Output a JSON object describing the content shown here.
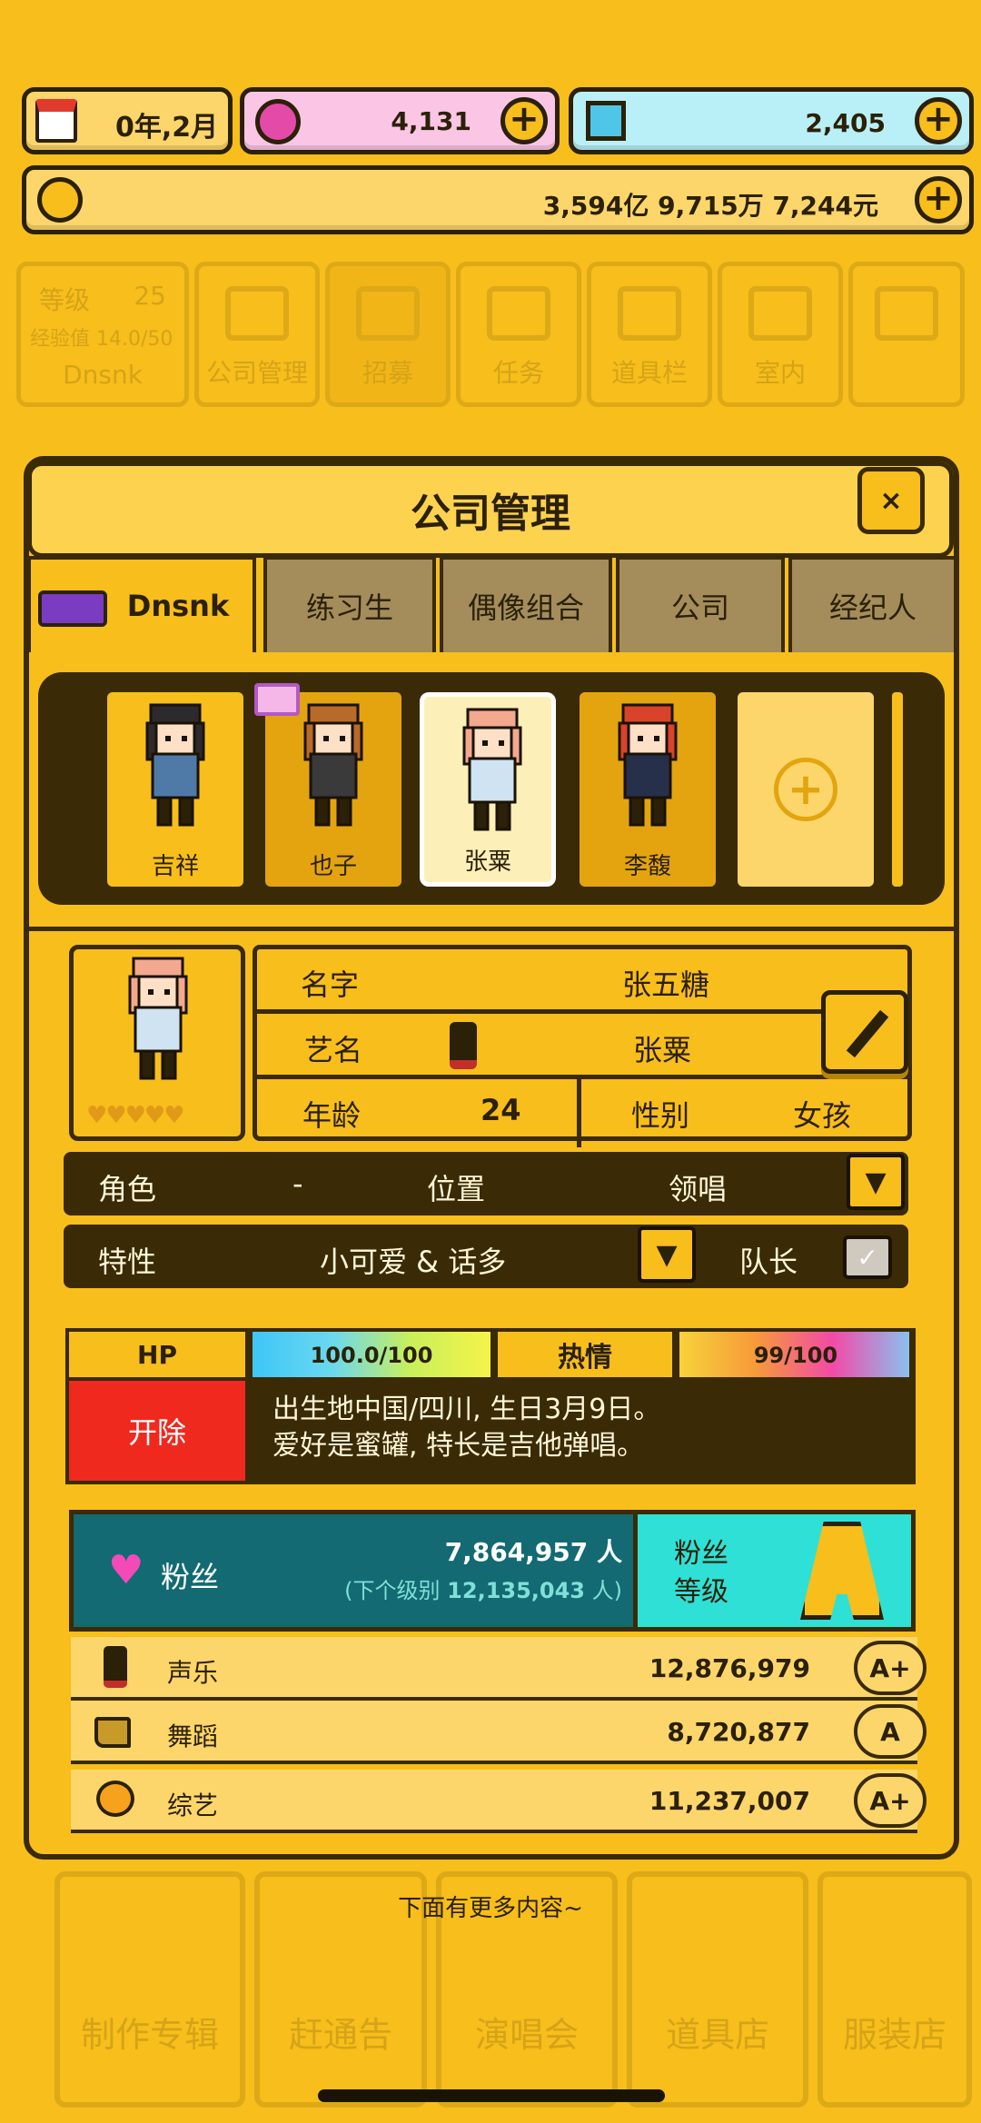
{
  "topbar": {
    "date": "0年,2月",
    "pink_currency": "4,131",
    "blue_currency": "2,405",
    "money": "3,594亿 9,715万 7,244元"
  },
  "background_menu": {
    "level_label": "等级",
    "level_value": "25",
    "exp_label": "经验值 14.0/50",
    "player_name": "Dnsnk",
    "tiles": [
      "公司管理",
      "招募",
      "任务",
      "道具栏",
      "室内"
    ],
    "bottom_tiles": [
      "制作专辑",
      "赶通告",
      "演唱会",
      "道具店",
      "服装店"
    ]
  },
  "modal": {
    "title": "公司管理",
    "close": "×",
    "tabs": [
      "Dnsnk",
      "练习生",
      "偶像组合",
      "公司",
      "经纪人"
    ]
  },
  "characters": [
    {
      "name": "吉祥",
      "hair": "#2d2a2e",
      "outfit": "#4f7aa8"
    },
    {
      "name": "也子",
      "hair": "#b86a2a",
      "outfit": "#3a3a3a"
    },
    {
      "name": "张粟",
      "hair": "#f2a98f",
      "outfit": "#cfe3f2"
    },
    {
      "name": "李馥",
      "hair": "#d8432a",
      "outfit": "#26304a"
    }
  ],
  "profile": {
    "name_label": "名字",
    "name_value": "张五糖",
    "stage_label": "艺名",
    "stage_value": "张粟",
    "age_label": "年龄",
    "age_value": "24",
    "gender_label": "性别",
    "gender_value": "女孩",
    "role_label": "角色",
    "role_value": "-",
    "position_label": "位置",
    "position_value": "领唱",
    "trait_label": "特性",
    "trait_value": "小可爱 & 话多",
    "leader_label": "队长",
    "hearts": 5
  },
  "status": {
    "hp_label": "HP",
    "hp_value": "100.0/100",
    "hp_fraction": 1.0,
    "passion_label": "热情",
    "passion_value": "99/100",
    "passion_fraction": 0.99,
    "fire_label": "开除",
    "bio_line1": "出生地中国/四川, 生日3月9日。",
    "bio_line2": "爱好是蜜罐, 特长是吉他弹唱。"
  },
  "fans": {
    "label": "粉丝",
    "count": "7,864,957 人",
    "next_prefix": "(下个级别 ",
    "next_value": "12,135,043",
    "next_suffix": " 人)",
    "level_label_1": "粉丝",
    "level_label_2": "等级"
  },
  "stats": [
    {
      "label": "声乐",
      "value": "12,876,979",
      "grade": "A+"
    },
    {
      "label": "舞蹈",
      "value": "8,720,877",
      "grade": "A"
    },
    {
      "label": "综艺",
      "value": "11,237,007",
      "grade": "A+"
    }
  ],
  "footer": "下面有更多内容~",
  "colors": {
    "bg": "#f7be1c",
    "dark": "#3a2a06",
    "pink_bar": "#fbc6e5",
    "blue_bar": "#b9f0f7",
    "fire_red": "#f0291f",
    "fans_teal": "#136a72",
    "fans_cyan": "#2ee0d6"
  }
}
